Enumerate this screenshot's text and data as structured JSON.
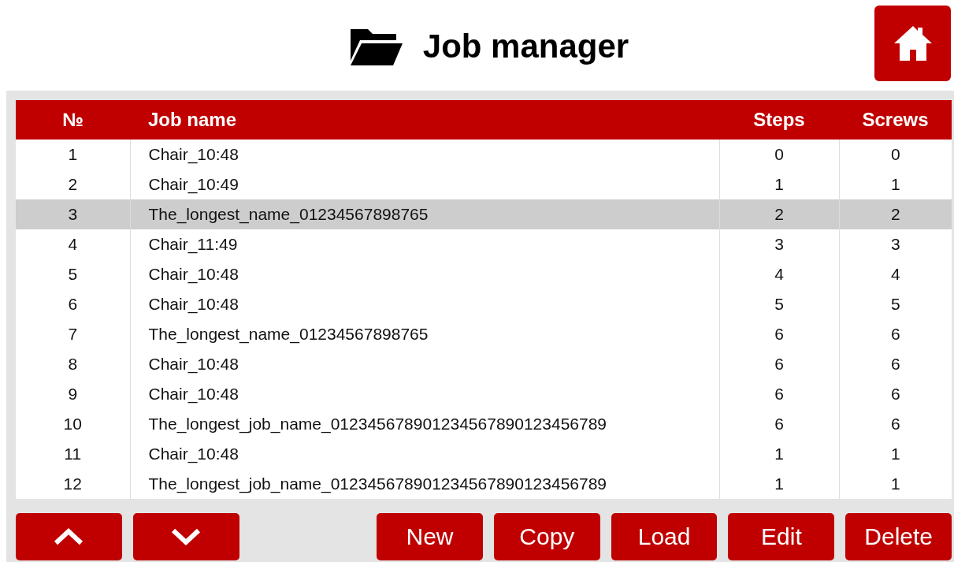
{
  "title": "Job manager",
  "table": {
    "columns": [
      "№",
      "Job name",
      "Steps",
      "Screws"
    ],
    "rows": [
      {
        "cells": [
          "1",
          "Chair_10:48",
          "0",
          "0"
        ],
        "selected": false
      },
      {
        "cells": [
          "2",
          "Chair_10:49",
          "1",
          "1"
        ],
        "selected": false
      },
      {
        "cells": [
          "3",
          "The_longest_name_01234567898765",
          "2",
          "2"
        ],
        "selected": true
      },
      {
        "cells": [
          "4",
          "Chair_11:49",
          "3",
          "3"
        ],
        "selected": false
      },
      {
        "cells": [
          "5",
          "Chair_10:48",
          "4",
          "4"
        ],
        "selected": false
      },
      {
        "cells": [
          "6",
          "Chair_10:48",
          "5",
          "5"
        ],
        "selected": false
      },
      {
        "cells": [
          "7",
          "The_longest_name_01234567898765",
          "6",
          "6"
        ],
        "selected": false
      },
      {
        "cells": [
          "8",
          "Chair_10:48",
          "6",
          "6"
        ],
        "selected": false
      },
      {
        "cells": [
          "9",
          "Chair_10:48",
          "6",
          "6"
        ],
        "selected": false
      },
      {
        "cells": [
          "10",
          "The_longest_job_name_012345678901234567890123456789",
          "6",
          "6"
        ],
        "selected": false
      },
      {
        "cells": [
          "11",
          "Chair_10:48",
          "1",
          "1"
        ],
        "selected": false
      },
      {
        "cells": [
          "12",
          "The_longest_job_name_012345678901234567890123456789",
          "1",
          "1"
        ],
        "selected": false
      }
    ]
  },
  "buttons": [
    {
      "kind": "up"
    },
    {
      "kind": "down"
    },
    {
      "kind": "text",
      "label": "New"
    },
    {
      "kind": "text",
      "label": "Copy"
    },
    {
      "kind": "text",
      "label": "Load"
    },
    {
      "kind": "text",
      "label": "Edit"
    },
    {
      "kind": "text",
      "label": "Delete"
    }
  ]
}
